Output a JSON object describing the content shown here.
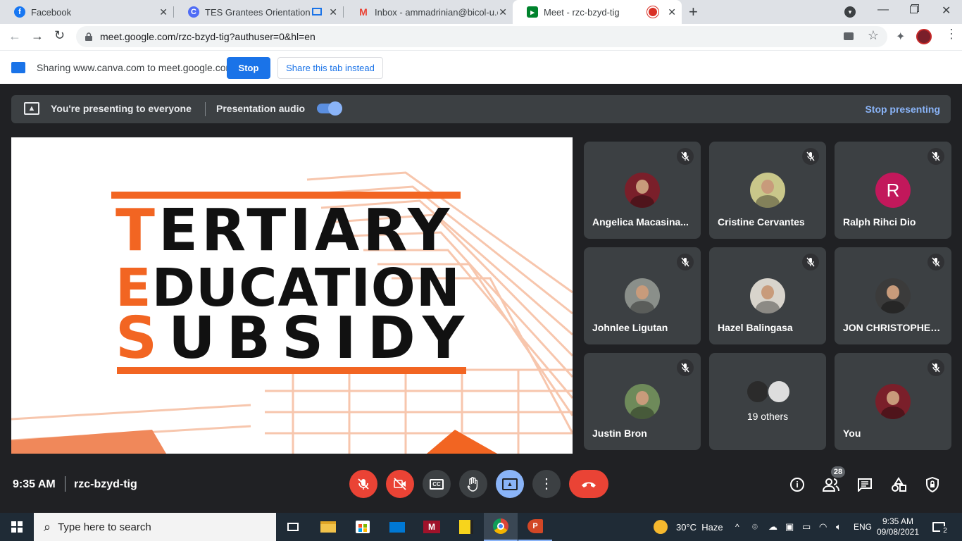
{
  "browser": {
    "tabs": [
      {
        "title": "Facebook",
        "icon": "facebook-icon",
        "color": "#1877f2",
        "active": false
      },
      {
        "title": "TES Grantees Orientation - P",
        "icon": "canva-icon",
        "color": "#4f6cf5",
        "active": false
      },
      {
        "title": "Inbox - ammadrinian@bicol-u.edu",
        "icon": "gmail-icon",
        "color": "#ea4335",
        "active": false
      },
      {
        "title": "Meet - rzc-bzyd-tig",
        "icon": "meet-icon",
        "color": "#00832d",
        "active": true
      }
    ],
    "url": "meet.google.com/rzc-bzyd-tig?authuser=0&hl=en"
  },
  "sharing": {
    "message": "Sharing www.canva.com to meet.google.com",
    "stop_label": "Stop",
    "share_tab_label": "Share this tab instead"
  },
  "presenting": {
    "message": "You're presenting to everyone",
    "audio_label": "Presentation audio",
    "audio_on": true,
    "stop_label": "Stop presenting"
  },
  "slide": {
    "line1_initial": "T",
    "line1_rest": "ERTIARY",
    "line2_initial": "E",
    "line2_rest": "DUCATION",
    "line3_initial": "S",
    "line3_rest": "UBSIDY",
    "accent": "#f26522"
  },
  "participants": [
    {
      "name": "Angelica Macasina...",
      "avatar": "photo",
      "bg": "#7a1f2a",
      "muted": true
    },
    {
      "name": "Cristine Cervantes",
      "avatar": "photo",
      "bg": "#c9c78a",
      "muted": true
    },
    {
      "name": "Ralph Rihci Dio",
      "avatar": "R",
      "bg": "#c2185b",
      "muted": true
    },
    {
      "name": "Johnlee Ligutan",
      "avatar": "photo",
      "bg": "#8a8f8a",
      "muted": true
    },
    {
      "name": "Hazel Balingasa",
      "avatar": "photo",
      "bg": "#d8d4cc",
      "muted": true
    },
    {
      "name": "JON CHRISTOPHER...",
      "avatar": "photo",
      "bg": "#3b3b3b",
      "muted": true
    },
    {
      "name": "Justin Bron",
      "avatar": "photo",
      "bg": "#6e8a5a",
      "muted": true
    },
    {
      "name": "19 others",
      "avatar": "group",
      "bg": "#555",
      "muted": false
    },
    {
      "name": "You",
      "avatar": "photo",
      "bg": "#7a1f2a",
      "muted": true
    }
  ],
  "meeting": {
    "time": "9:35 AM",
    "code": "rzc-bzyd-tig",
    "people_count": "28"
  },
  "taskbar": {
    "search_placeholder": "Type here to search",
    "weather": "30°C  Haze",
    "language": "ENG",
    "clock_time": "9:35 AM",
    "clock_date": "09/08/2021",
    "notifications": "2"
  }
}
